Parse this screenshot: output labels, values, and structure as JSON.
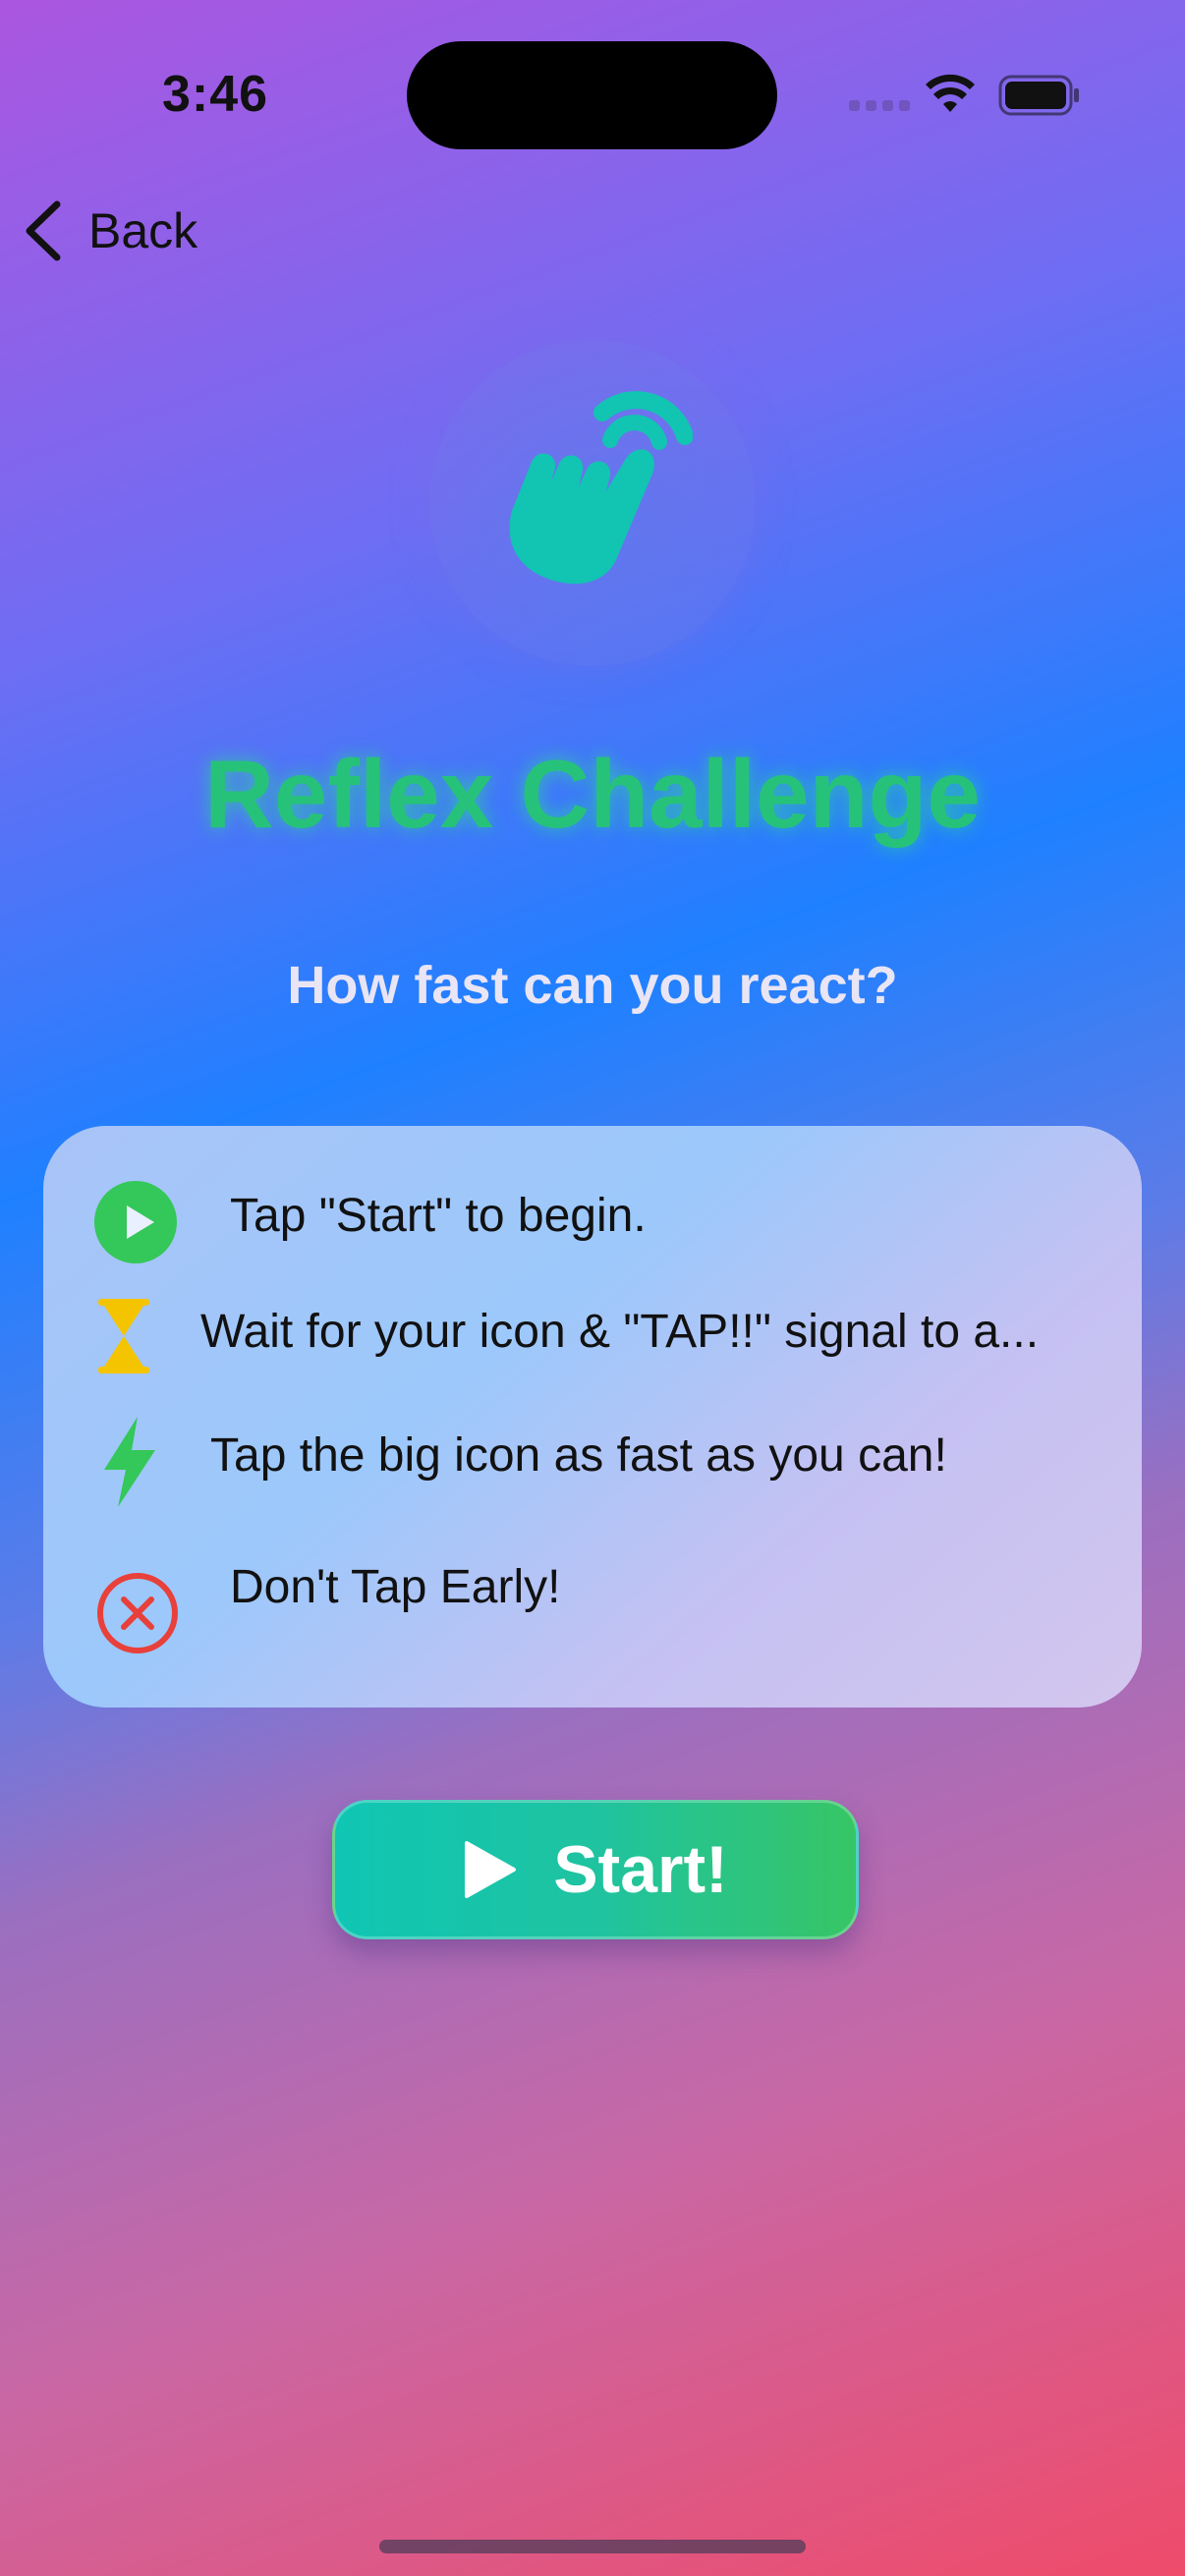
{
  "status_bar": {
    "time": "3:46"
  },
  "nav": {
    "back_label": "Back"
  },
  "hero": {
    "icon": "hand-tap-icon"
  },
  "header": {
    "title": "Reflex Challenge",
    "subtitle": "How fast can you react?"
  },
  "instructions": [
    {
      "icon": "play-circle-icon",
      "text": "Tap \"Start\" to begin."
    },
    {
      "icon": "hourglass-icon",
      "text": "Wait for your icon & \"TAP!!\" signal to a..."
    },
    {
      "icon": "bolt-icon",
      "text": "Tap the big icon as fast as you can!"
    },
    {
      "icon": "x-circle-icon",
      "text": "Don't Tap Early!"
    }
  ],
  "start_button": {
    "label": "Start!"
  },
  "colors": {
    "accent_green": "#34c759",
    "title_green": "#26c27a",
    "hourglass_yellow": "#f5c400",
    "danger_red": "#e8403a"
  }
}
